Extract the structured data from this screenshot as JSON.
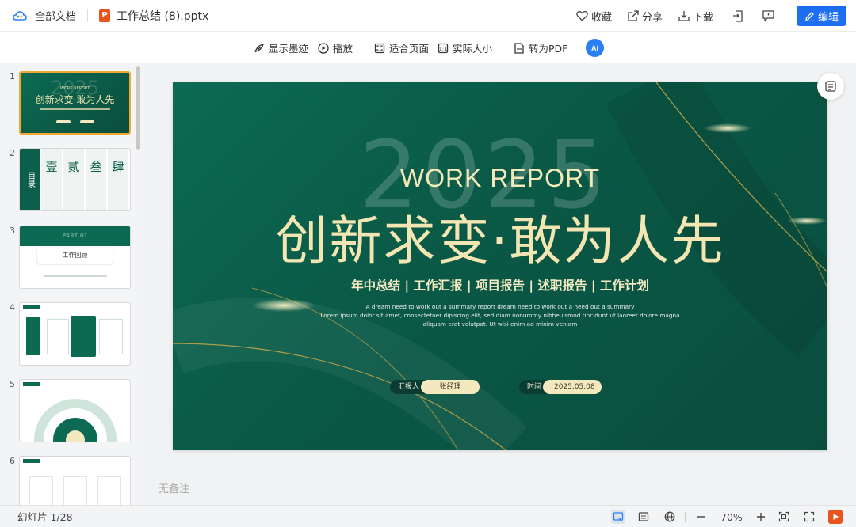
{
  "topbar": {
    "all_docs": "全部文档",
    "filename": "工作总结 (8).pptx",
    "pptx_badge": "P",
    "favorite": "收藏",
    "share": "分享",
    "download": "下载",
    "edit": "编辑"
  },
  "toolbar": {
    "show_ink": "显示墨迹",
    "play": "播放",
    "fit_page": "适合页面",
    "actual_size": "实际大小",
    "to_pdf": "转为PDF",
    "ai_label": "Ai"
  },
  "sidebar": {
    "thumbs": [
      {
        "num": "1",
        "title": "创新求变·敢为人先",
        "sub": "WORK REPORT"
      },
      {
        "num": "2",
        "chars": [
          "目录",
          "壹",
          "贰",
          "叁",
          "肆"
        ]
      },
      {
        "num": "3",
        "title": "工作回顾",
        "part": "PART 01"
      },
      {
        "num": "4"
      },
      {
        "num": "5"
      },
      {
        "num": "6"
      }
    ]
  },
  "slide": {
    "year": "2025",
    "work_report": "WORK REPORT",
    "title": "创新求变·敢为人先",
    "subtitle": "年中总结 | 工作汇报 | 项目报告 | 述职报告 | 工作计划",
    "desc_1": "A dream need to work out a summary report dream need to work out a need out a summary",
    "desc_2": "Lorem ipsum dolor sit amet, consectetuer dipiscing elit, sed diam nonummy nibheuismod tincidunt ut laoreet dolore magna",
    "desc_3": "aliquam erat volutpat. Ut wisi enim ad minim veniam",
    "reporter_label": "汇报人",
    "reporter": "张经理",
    "time_label": "时间",
    "date": "2025.05.08"
  },
  "notes": "无备注",
  "status": {
    "slide_counter": "幻灯片 1/28",
    "zoom": "70%"
  },
  "colors": {
    "accent": "#1e6ef2",
    "slide_green": "#0b5f4a",
    "gold": "#f3e6b2",
    "active_thumb": "#f0a832"
  }
}
